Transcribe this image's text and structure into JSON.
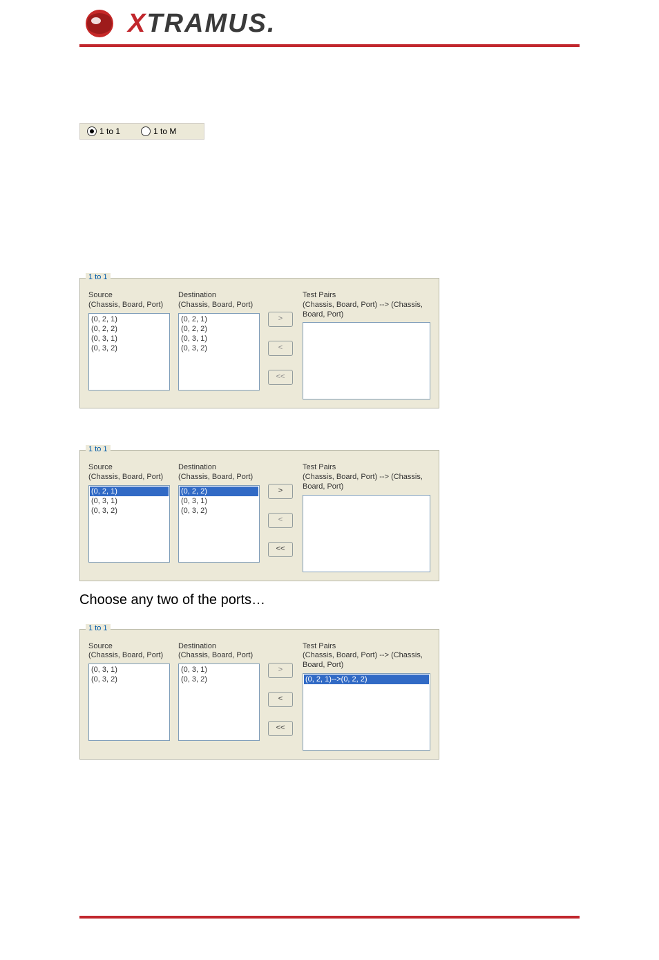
{
  "brand": {
    "text_a": "X",
    "text_b": "TRAMUS"
  },
  "radios": {
    "opt1": {
      "label": "1 to 1",
      "selected": true
    },
    "opt2": {
      "label": "1 to M",
      "selected": false
    }
  },
  "panel_legend": "1 to 1",
  "headers": {
    "source_title": "Source",
    "source_sub": "(Chassis, Board, Port)",
    "dest_title": "Destination",
    "dest_sub": "(Chassis, Board, Port)",
    "pairs_title": "Test Pairs",
    "pairs_sub": "(Chassis, Board, Port) --> (Chassis, Board, Port)"
  },
  "buttons": {
    "add": ">",
    "remove": "<",
    "clear": "<<"
  },
  "fig1": {
    "source": [
      "(0, 2, 1)",
      "(0, 2, 2)",
      "(0, 3, 1)",
      "(0, 3, 2)"
    ],
    "dest": [
      "(0, 2, 1)",
      "(0, 2, 2)",
      "(0, 3, 1)",
      "(0, 3, 2)"
    ],
    "pairs": []
  },
  "fig2": {
    "source": [
      "(0, 2, 1)",
      "(0, 3, 1)",
      "(0, 3, 2)"
    ],
    "dest": [
      "(0, 2, 2)",
      "(0, 3, 1)",
      "(0, 3, 2)"
    ],
    "selected_src_idx": 0,
    "selected_dst_idx": 0,
    "pairs": []
  },
  "caption_choose": "Choose any two of the ports…",
  "fig3": {
    "source": [
      "(0, 3, 1)",
      "(0, 3, 2)"
    ],
    "dest": [
      "(0, 3, 1)",
      "(0, 3, 2)"
    ],
    "pairs": [
      "(0, 2, 1)-->(0, 2, 2)"
    ],
    "selected_pair_idx": 0
  }
}
